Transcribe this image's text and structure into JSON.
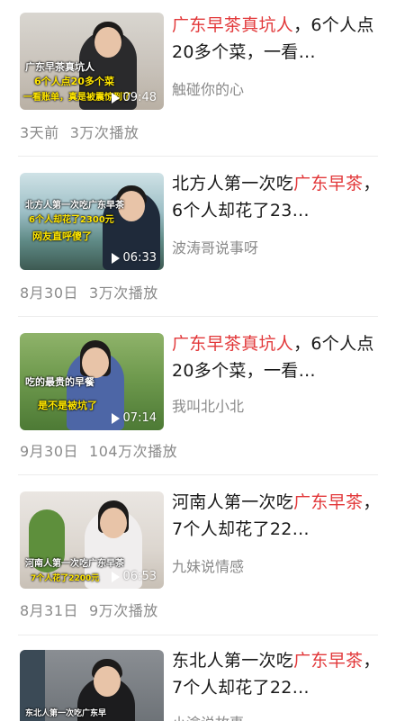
{
  "items": [
    {
      "title_kw": "广东早茶真坑人",
      "title_rest": "，6个人点20多个菜，一看…",
      "author": "触碰你的心",
      "duration": "09:48",
      "date": "3天前",
      "plays": "3万次播放",
      "caption1": "广东早茶真坑人",
      "caption2": "6个人点20多个菜",
      "caption3": "一看账单，真是被震惊到了"
    },
    {
      "title_pre": "北方人第一次吃",
      "title_kw": "广东早茶",
      "title_rest": "，6个人却花了23…",
      "author": "波涛哥说事呀",
      "duration": "06:33",
      "date": "8月30日",
      "plays": "3万次播放",
      "caption1": "北方人第一次吃广东早茶",
      "caption2": "6个人却花了2300元",
      "caption3": "网友直呼傻了"
    },
    {
      "title_kw": "广东早茶真坑人",
      "title_rest": "，6个人点20多个菜，一看…",
      "author": "我叫北小北",
      "duration": "07:14",
      "date": "9月30日",
      "plays": "104万次播放",
      "caption1": "吃的最贵的早餐",
      "caption2": "是不是被坑了"
    },
    {
      "title_pre": "河南人第一次吃",
      "title_kw": "广东早茶",
      "title_rest": "，7个人却花了22…",
      "author": "九妹说情感",
      "duration": "06:53",
      "date": "8月31日",
      "plays": "9万次播放",
      "caption1": "河南人第一次吃广东早茶",
      "caption2": "7个人花了2200元"
    },
    {
      "title_pre": "东北人第一次吃",
      "title_kw": "广东早茶",
      "title_rest": "，7个人却花了22…",
      "author": "小渝说故事",
      "caption1": "东北人第一次吃广东早"
    }
  ]
}
